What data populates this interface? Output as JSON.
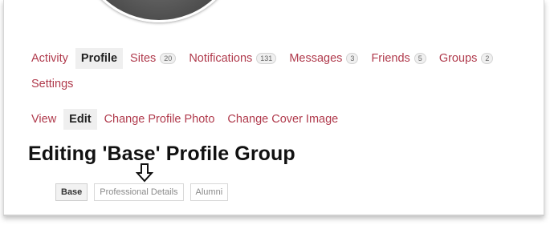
{
  "nav": {
    "items": [
      {
        "label": "Activity"
      },
      {
        "label": "Profile",
        "active": true
      },
      {
        "label": "Sites",
        "count": "20"
      },
      {
        "label": "Notifications",
        "count": "131"
      },
      {
        "label": "Messages",
        "count": "3"
      },
      {
        "label": "Friends",
        "count": "5"
      },
      {
        "label": "Groups",
        "count": "2"
      },
      {
        "label": "Settings"
      }
    ]
  },
  "subnav": {
    "items": [
      {
        "label": "View"
      },
      {
        "label": "Edit",
        "active": true
      },
      {
        "label": "Change Profile Photo"
      },
      {
        "label": "Change Cover Image"
      }
    ]
  },
  "page": {
    "title": "Editing 'Base' Profile Group"
  },
  "tabs": [
    {
      "label": "Base",
      "active": true
    },
    {
      "label": "Professional Details"
    },
    {
      "label": "Alumni"
    }
  ],
  "icons": {
    "avatar": "avatar-photo",
    "annotation": "down-arrow-icon"
  },
  "colors": {
    "link": "#b03a4c",
    "active_bg": "#efefef"
  }
}
